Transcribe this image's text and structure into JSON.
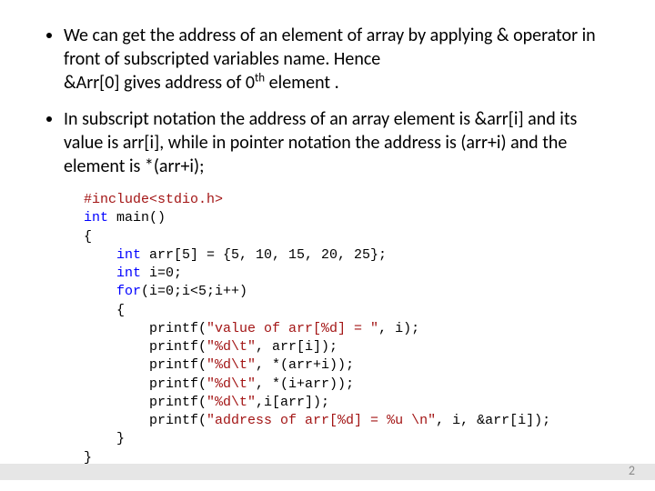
{
  "bullets": {
    "b1_a": "We can get the address of an element of array by applying & operator in front of subscripted variables name. Hence",
    "b1_b": "&Arr[0] gives address of 0",
    "b1_c": " element .",
    "sup": "th",
    "b2": "In subscript notation the address of an array element is &arr[i] and its value is arr[i], while in pointer notation the address is (arr+i) and the element is *(arr+i);"
  },
  "code": {
    "l01a": "#include",
    "l01b": "<stdio.h>",
    "l02a": "int",
    "l02b": " main()",
    "l03": "{",
    "l04a": "    int",
    "l04b": " arr[5] = {5, 10, 15, 20, 25};",
    "l05a": "    int",
    "l05b": " i=0;",
    "l06a": "    for",
    "l06b": "(i=0;i<5;i++)",
    "l07": "    {",
    "l08a": "        printf(",
    "l08b": "\"value of arr[%d] = \"",
    "l08c": ", i);",
    "l09a": "        printf(",
    "l09b": "\"%d\\t\"",
    "l09c": ", arr[i]);",
    "l10a": "        printf(",
    "l10b": "\"%d\\t\"",
    "l10c": ", *(arr+i));",
    "l11a": "        printf(",
    "l11b": "\"%d\\t\"",
    "l11c": ", *(i+arr));",
    "l12a": "        printf(",
    "l12b": "\"%d\\t\"",
    "l12c": ",i[arr]);",
    "l13a": "        printf(",
    "l13b": "\"address of arr[%d] = %u \\n\"",
    "l13c": ", i, &arr[i]);",
    "l14": "    }",
    "l15": "}"
  },
  "page_number": "2"
}
